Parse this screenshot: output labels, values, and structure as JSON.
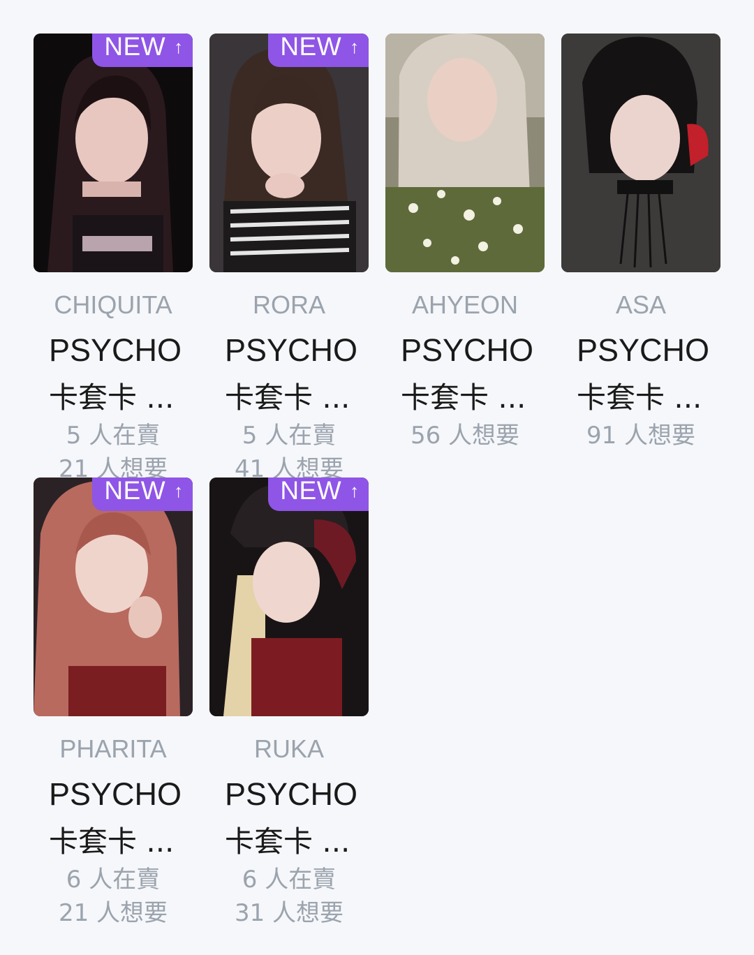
{
  "colors": {
    "background": "#f5f7fa",
    "badge": "#8f55e6",
    "muted_text": "#9ba3ad",
    "title_text": "#1a1a1a"
  },
  "badge_icon": "arrow-up-icon",
  "cards": [
    {
      "badge": "NEW",
      "badge_arrow": "↑",
      "member": "CHIQUITA",
      "title_line1": "PSYCHO",
      "title_line2": "卡套卡 ...",
      "stat1": "5 人在賣",
      "stat2": "21 人想要"
    },
    {
      "badge": "NEW",
      "badge_arrow": "↑",
      "member": "RORA",
      "title_line1": "PSYCHO",
      "title_line2": "卡套卡 ...",
      "stat1": "5 人在賣",
      "stat2": "41 人想要"
    },
    {
      "badge": "",
      "badge_arrow": "",
      "member": "AHYEON",
      "title_line1": "PSYCHO",
      "title_line2": "卡套卡 ...",
      "stat1": "56 人想要",
      "stat2": ""
    },
    {
      "badge": "",
      "badge_arrow": "",
      "member": "ASA",
      "title_line1": "PSYCHO",
      "title_line2": "卡套卡 ...",
      "stat1": "91 人想要",
      "stat2": ""
    },
    {
      "badge": "NEW",
      "badge_arrow": "↑",
      "member": "PHARITA",
      "title_line1": "PSYCHO",
      "title_line2": "卡套卡 ...",
      "stat1": "6 人在賣",
      "stat2": "21 人想要"
    },
    {
      "badge": "NEW",
      "badge_arrow": "↑",
      "member": "RUKA",
      "title_line1": "PSYCHO",
      "title_line2": "卡套卡 ...",
      "stat1": "6 人在賣",
      "stat2": "31 人想要"
    }
  ]
}
